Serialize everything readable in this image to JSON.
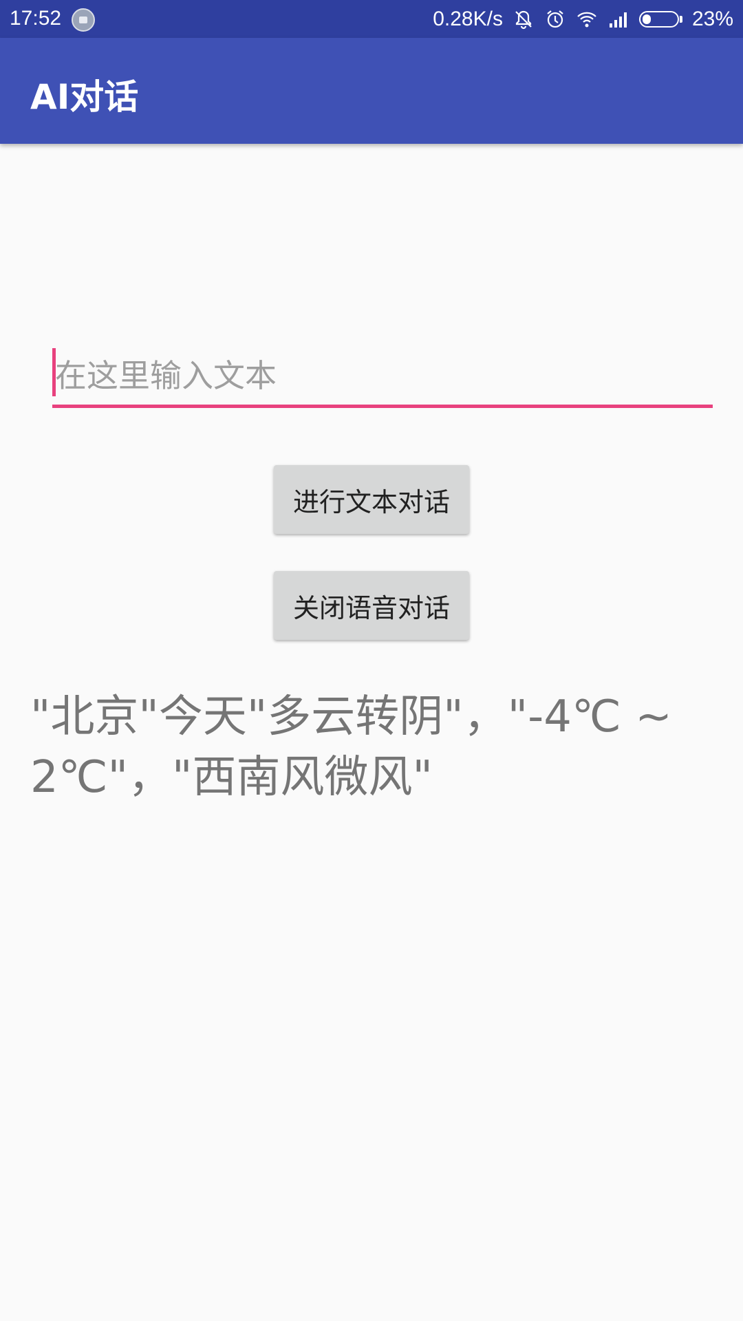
{
  "status_bar": {
    "time": "17:52",
    "network_speed": "0.28K/s",
    "battery_percent": "23%",
    "battery_level": 0.23,
    "icons": [
      "notification-app-icon",
      "mute-bell-icon",
      "alarm-icon",
      "wifi-icon",
      "cell-signal-icon",
      "battery-icon"
    ]
  },
  "app_bar": {
    "title": "AI对话"
  },
  "input": {
    "placeholder": "在这里输入文本",
    "value": ""
  },
  "buttons": {
    "text_chat": "进行文本对话",
    "voice_chat": "关闭语音对话"
  },
  "response": {
    "text": "\"北京\"今天\"多云转阴\"，\"-4℃ ~ 2℃\"，\"西南风微风\""
  },
  "colors": {
    "status_bar": "#2f3f9f",
    "app_bar": "#3f51b5",
    "accent": "#e8417e",
    "button_bg": "#d6d7d7",
    "background": "#fafafa",
    "response_text": "#757575"
  }
}
